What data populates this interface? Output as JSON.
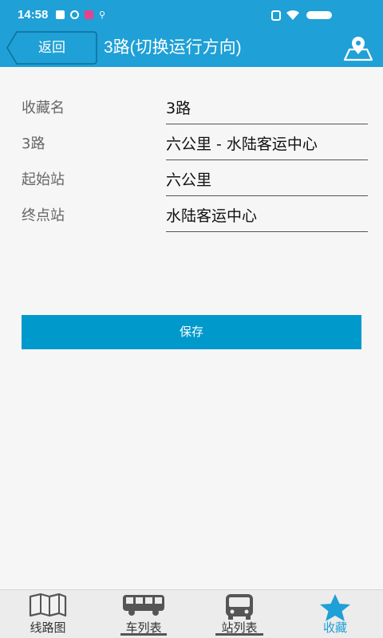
{
  "status_bar": {
    "time": "14:58"
  },
  "header": {
    "back_label": "返回",
    "title": "3路(切换运行方向)"
  },
  "form": {
    "fields": [
      {
        "label": "收藏名",
        "value": "3路"
      },
      {
        "label": "3路",
        "value": "六公里 - 水陆客运中心"
      },
      {
        "label": "起始站",
        "value": "六公里"
      },
      {
        "label": "终点站",
        "value": "水陆客运中心"
      }
    ],
    "save_label": "保存"
  },
  "bottom_nav": {
    "items": [
      {
        "label": "线路图",
        "icon": "map-icon",
        "active": false
      },
      {
        "label": "车列表",
        "icon": "bus-side-icon",
        "active": false
      },
      {
        "label": "站列表",
        "icon": "bus-front-icon",
        "active": false
      },
      {
        "label": "收藏",
        "icon": "star-icon",
        "active": true
      }
    ]
  },
  "colors": {
    "primary": "#1fa0d6",
    "button": "#0099cc",
    "background": "#f6f6f6"
  }
}
